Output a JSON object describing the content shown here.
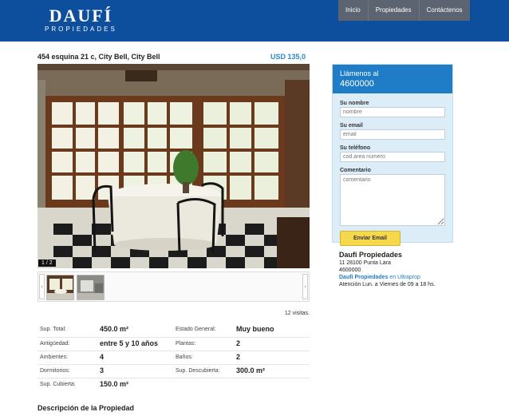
{
  "brand": {
    "name": "DAUFÍ",
    "tagline": "PROPIEDADES"
  },
  "nav": {
    "items": [
      "Inicio",
      "Propiedades",
      "Contáctenos"
    ]
  },
  "property": {
    "title": "454 esquina 21 c, City Bell, City Bell",
    "price": "USD  135,0",
    "photo_counter": "1 / 2"
  },
  "visits": "12 visitas.",
  "features": [
    {
      "label1": "Sup. Total:",
      "value1": "450.0 m²",
      "label2": "Estado General:",
      "value2": "Muy bueno"
    },
    {
      "label1": "Antigüedad:",
      "value1": "entre 5 y 10 años",
      "label2": "Plantas:",
      "value2": "2"
    },
    {
      "label1": "Ambientes:",
      "value1": "4",
      "label2": "Baños:",
      "value2": "2"
    },
    {
      "label1": "Dormitorios:",
      "value1": "3",
      "label2": "Sup. Descubierta:",
      "value2": "300.0 m²"
    },
    {
      "label1": "Sup. Cubierta:",
      "value1": "150.0 m²",
      "label2": "",
      "value2": ""
    }
  ],
  "description_title": "Descripción de la Propiedad",
  "contact": {
    "heading_line1": "Llámenos al",
    "heading_line2": "4600000",
    "name_label": "Su nombre",
    "name_placeholder": "nombre",
    "email_label": "Su email",
    "email_placeholder": "email",
    "phone_label": "Su teléfono",
    "phone_placeholder": "cód.area número",
    "comment_label": "Comentario",
    "comment_placeholder": "comentario",
    "send_label": "Enviar Email"
  },
  "agency": {
    "name": "Daufi Propiedades",
    "address": "11 28100 Punta Lara",
    "phone": "4600000",
    "link_bold": "Daufi Propiedades",
    "link_rest": " en Ultraprop",
    "hours": "Atención Lun. a Viernes de 09 a 18 hs."
  },
  "colors": {
    "header": "#0d4f9d",
    "nav": "#5b6470",
    "accent": "#1f7cc6",
    "button": "#f7d84c"
  }
}
